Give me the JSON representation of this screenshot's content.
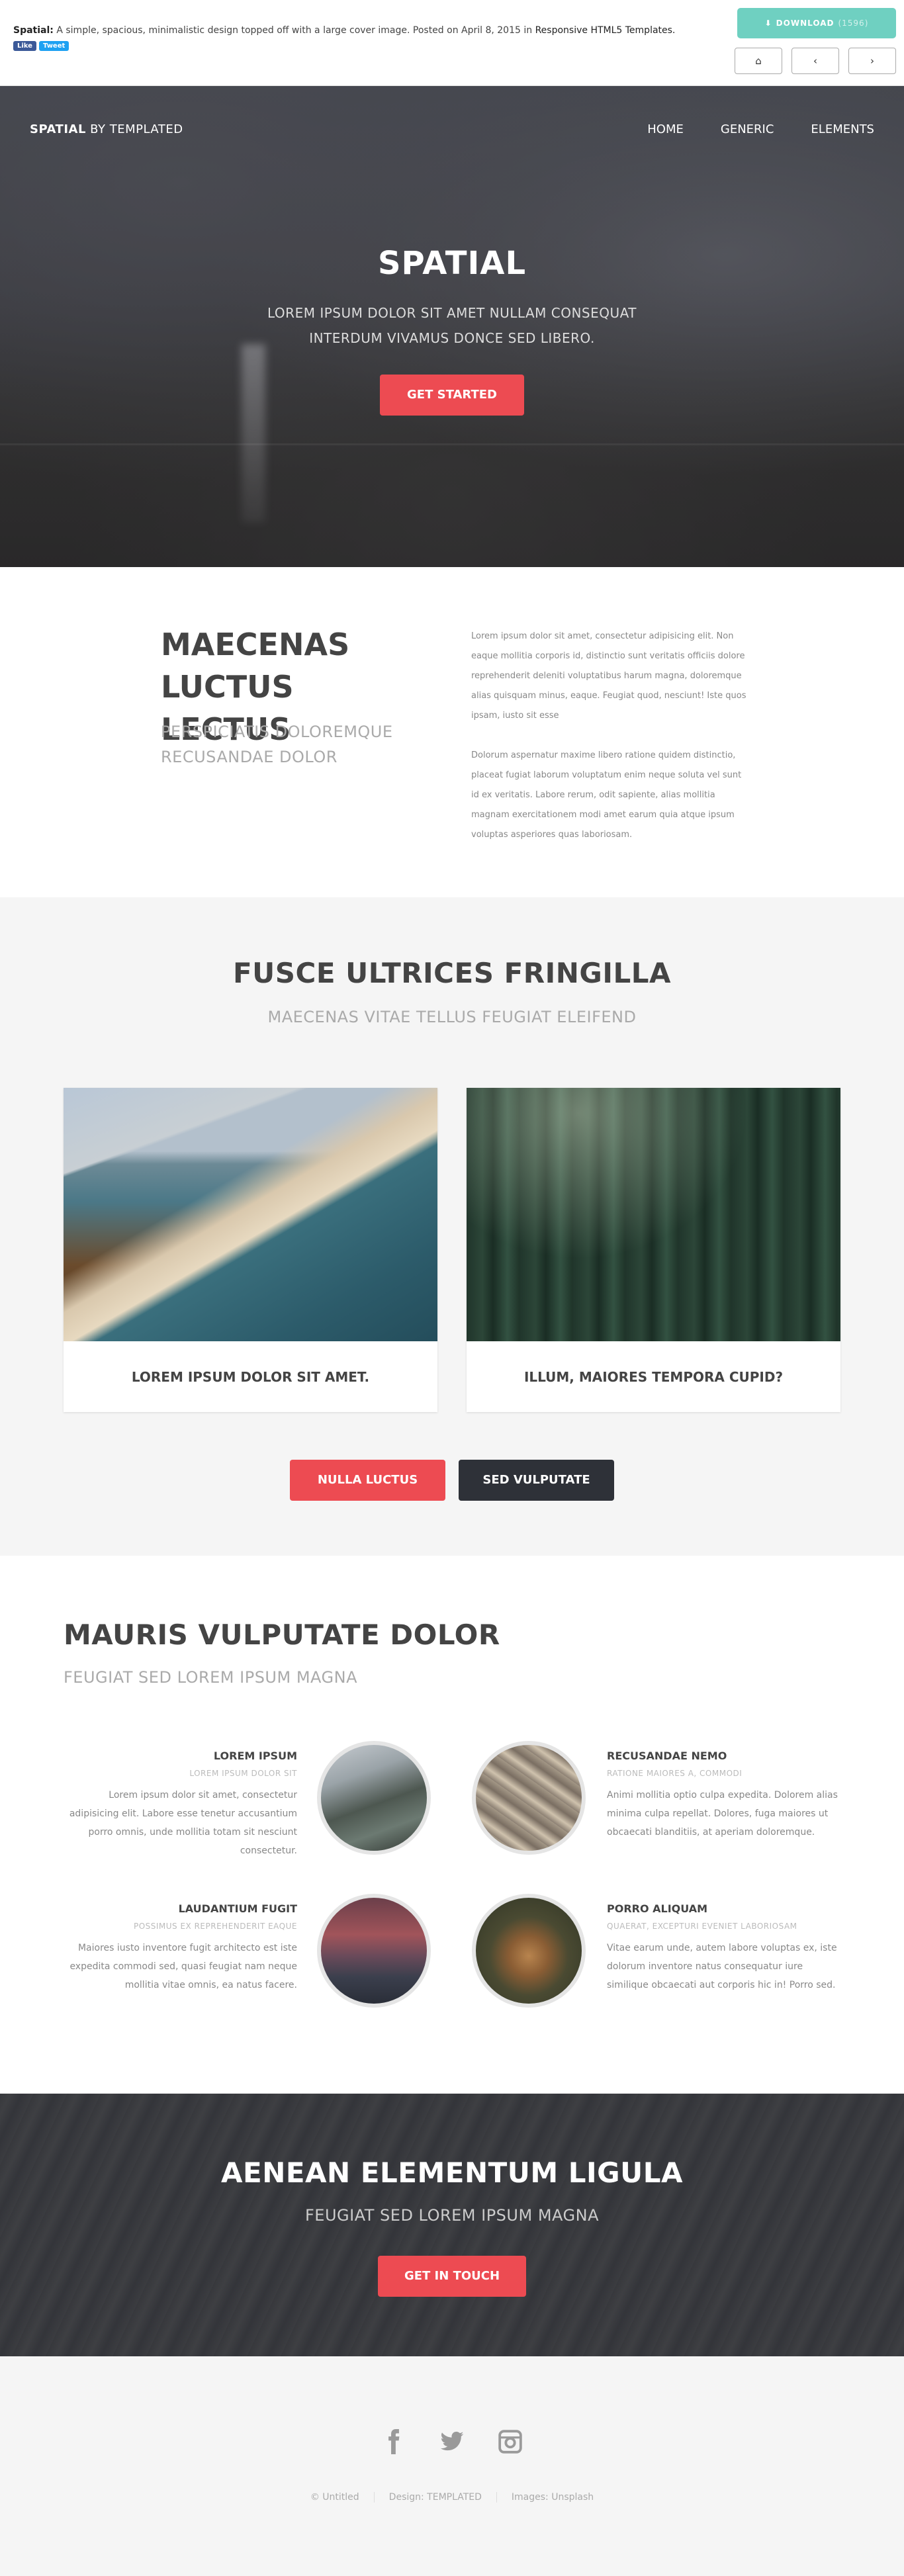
{
  "topbar": {
    "title": "Spatial:",
    "description": "A simple, spacious, minimalistic design topped off with a large cover image. Posted on April 8, 2015 in",
    "link": "Responsive HTML5 Templates.",
    "like_label": "Like",
    "tweet_label": "Tweet",
    "download_label": "DOWNLOAD",
    "download_count": "(1596)"
  },
  "header": {
    "logo_bold": "SPATIAL",
    "logo_rest": "BY TEMPLATED",
    "menu": [
      "HOME",
      "GENERIC",
      "ELEMENTS"
    ]
  },
  "banner": {
    "title": "SPATIAL",
    "subtitle_line1": "LOREM IPSUM DOLOR SIT AMET NULLAM CONSEQUAT",
    "subtitle_line2": "INTERDUM VIVAMUS DONCE SED LIBERO.",
    "button": "GET STARTED"
  },
  "intro": {
    "title_line1": "MAECENAS",
    "title_line2": "LUCTUS LECTUS",
    "subtitle_line1": "PERSPICIATIS DOLOREMQUE",
    "subtitle_line2": "RECUSANDAE DOLOR",
    "para1": "Lorem ipsum dolor sit amet, consectetur adipisicing elit. Non eaque mollitia corporis id, distinctio sunt veritatis officiis dolore reprehenderit deleniti voluptatibus harum magna, doloremque alias quisquam minus, eaque. Feugiat quod, nesciunt! Iste quos ipsam, iusto sit esse",
    "para2": "Dolorum aspernatur maxime libero ratione quidem distinctio, placeat fugiat laborum voluptatum enim neque soluta vel sunt id ex veritatis. Labore rerum, odit sapiente, alias mollitia magnam exercitationem modi amet earum quia atque ipsum voluptas asperiores quas laboriosam."
  },
  "gallery": {
    "title": "FUSCE ULTRICES FRINGILLA",
    "subtitle": "MAECENAS VITAE TELLUS FEUGIAT ELEIFEND",
    "cards": [
      {
        "caption": "LOREM IPSUM DOLOR SIT AMET."
      },
      {
        "caption": "ILLUM, MAIORES TEMPORA CUPID?"
      }
    ],
    "button_primary": "NULLA LUCTUS",
    "button_secondary": "SED VULPUTATE"
  },
  "features": {
    "title": "MAURIS VULPUTATE DOLOR",
    "subtitle": "FEUGIAT SED LOREM IPSUM MAGNA",
    "items": [
      {
        "title": "LOREM IPSUM",
        "subtitle": "LOREM IPSUM DOLOR SIT",
        "text": "Lorem ipsum dolor sit amet, consectetur adipisicing elit. Labore esse tenetur accusantium porro omnis, unde mollitia totam sit nesciunt consectetur."
      },
      {
        "title": "RECUSANDAE NEMO",
        "subtitle": "RATIONE MAIORES A, COMMODI",
        "text": "Animi mollitia optio culpa expedita. Dolorem alias minima culpa repellat. Dolores, fuga maiores ut obcaecati blanditiis, at aperiam doloremque."
      },
      {
        "title": "LAUDANTIUM FUGIT",
        "subtitle": "POSSIMUS EX REPREHENDERIT EAQUE",
        "text": "Maiores iusto inventore fugit architecto est iste expedita commodi sed, quasi feugiat nam neque mollitia vitae omnis, ea natus facere."
      },
      {
        "title": "PORRO ALIQUAM",
        "subtitle": "QUAERAT, EXCEPTURI EVENIET LABORIOSAM",
        "text": "Vitae earum unde, autem labore voluptas ex, iste dolorum inventore natus consequatur iure similique obcaecati aut corporis hic in! Porro sed."
      }
    ]
  },
  "cta": {
    "title": "AENEAN ELEMENTUM LIGULA",
    "subtitle": "FEUGIAT SED LOREM IPSUM MAGNA",
    "button": "GET IN TOUCH"
  },
  "footer": {
    "icons": [
      "facebook-icon",
      "twitter-icon",
      "instagram-icon"
    ],
    "copyright": [
      "© Untitled",
      "Design: TEMPLATED",
      "Images: Unsplash"
    ]
  },
  "colors": {
    "accent": "#ed4b52",
    "dark_button": "#2e3138",
    "download": "#6fd0c1"
  }
}
